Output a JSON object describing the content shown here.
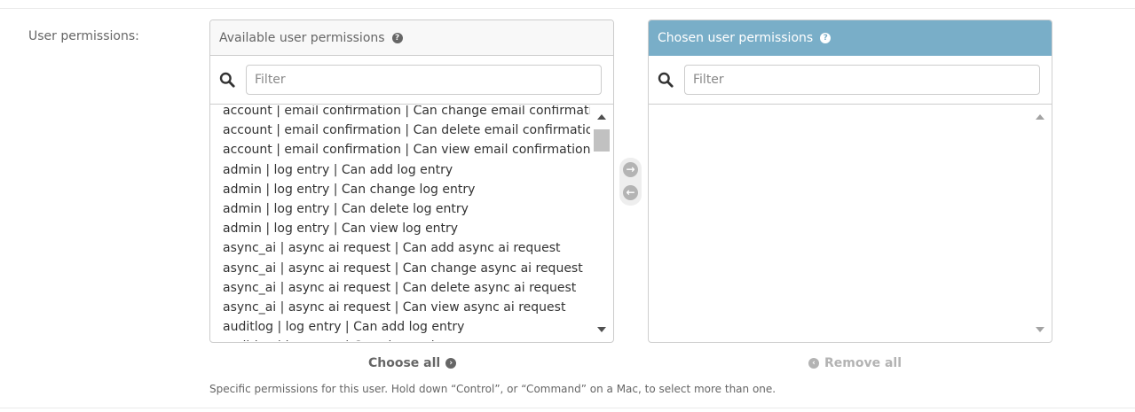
{
  "field": {
    "label": "User permissions:",
    "help_text": "Specific permissions for this user. Hold down “Control”, or “Command” on a Mac, to select more than one."
  },
  "available": {
    "title": "Available user permissions",
    "help_glyph": "?",
    "filter_placeholder": "Filter",
    "options": [
      "account | email confirmation | Can change email confirmation",
      "account | email confirmation | Can delete email confirmation",
      "account | email confirmation | Can view email confirmation",
      "admin | log entry | Can add log entry",
      "admin | log entry | Can change log entry",
      "admin | log entry | Can delete log entry",
      "admin | log entry | Can view log entry",
      "async_ai | async ai request | Can add async ai request",
      "async_ai | async ai request | Can change async ai request",
      "async_ai | async ai request | Can delete async ai request",
      "async_ai | async ai request | Can view async ai request",
      "auditlog | log entry | Can add log entry",
      "auditlog | log entry | Can change log entry"
    ],
    "scroll_position": 0.08
  },
  "chosen": {
    "title": "Chosen user permissions",
    "help_glyph": "?",
    "filter_placeholder": "Filter",
    "options": []
  },
  "mover": {
    "add_glyph": "→",
    "remove_glyph": "←"
  },
  "actions": {
    "choose_all_label": "Choose all",
    "choose_all_glyph": "›",
    "remove_all_label": "Remove all",
    "remove_all_glyph": "‹"
  },
  "colors": {
    "chosen_header_bg": "#79aec8",
    "available_header_bg": "#f8f8f8",
    "border": "#cccccc"
  },
  "icons": {
    "search": "search-icon",
    "help": "question-circle-icon",
    "add": "arrow-right-circle-icon",
    "remove": "arrow-left-circle-icon"
  }
}
